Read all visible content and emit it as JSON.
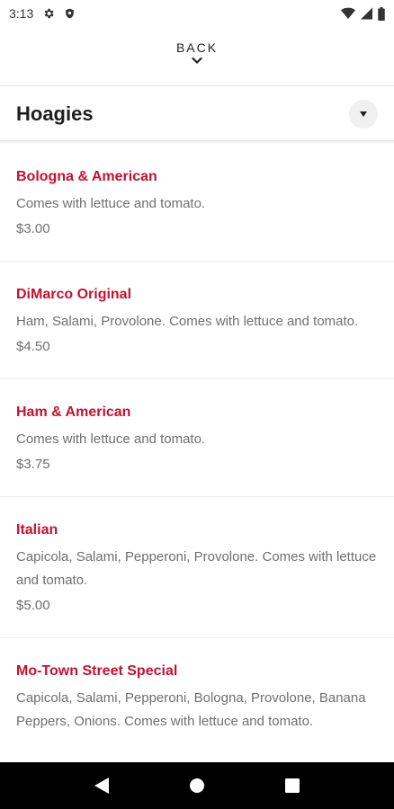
{
  "status_bar": {
    "time": "3:13",
    "left_icons": [
      "gear-icon",
      "shield-icon"
    ],
    "right_icons": [
      "wifi-icon",
      "signal-icon",
      "battery-icon"
    ]
  },
  "header": {
    "back_label": "BACK"
  },
  "category": {
    "title": "Hoagies"
  },
  "menu_items": [
    {
      "name": "Bologna & American",
      "description": "Comes with lettuce and tomato.",
      "price": "$3.00"
    },
    {
      "name": "DiMarco Original",
      "description": "Ham, Salami, Provolone. Comes with lettuce and tomato.",
      "price": "$4.50"
    },
    {
      "name": "Ham & American",
      "description": "Comes with lettuce and tomato.",
      "price": "$3.75"
    },
    {
      "name": "Italian",
      "description": "Capicola, Salami, Pepperoni, Provolone. Comes with lettuce and tomato.",
      "price": "$5.00"
    },
    {
      "name": "Mo-Town Street Special",
      "description": "Capicola, Salami, Pepperoni, Bologna, Provolone, Banana Peppers, Onions. Comes with lettuce and tomato.",
      "price": ""
    }
  ],
  "nav_bar": {
    "buttons": [
      "back-triangle-icon",
      "home-circle-icon",
      "recents-square-icon"
    ]
  },
  "colors": {
    "accent": "#c8102e",
    "text_secondary": "#6f6f6f",
    "nav_background": "#000000"
  }
}
